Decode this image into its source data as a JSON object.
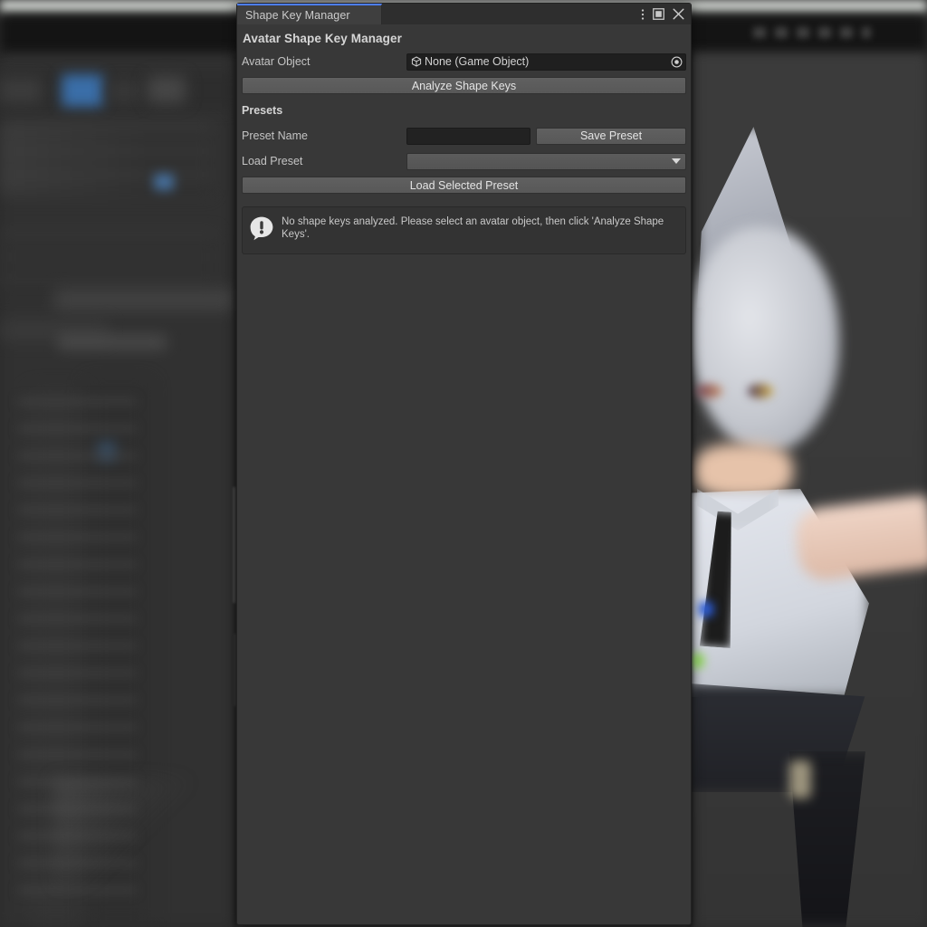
{
  "window": {
    "tab_label": "Shape Key Manager",
    "menu_icon": "kebab-menu-icon",
    "maximize_icon": "maximize-icon",
    "close_icon": "close-icon"
  },
  "header": {
    "title": "Avatar Shape Key Manager"
  },
  "avatar_object": {
    "label": "Avatar Object",
    "value": "None (Game Object)",
    "type_icon": "gameobject-cube-icon",
    "picker_icon": "object-picker-icon"
  },
  "analyze": {
    "label": "Analyze Shape Keys"
  },
  "presets": {
    "section_label": "Presets",
    "preset_name_label": "Preset Name",
    "preset_name_value": "",
    "preset_name_placeholder": "",
    "save_label": "Save Preset",
    "load_preset_label": "Load Preset",
    "load_preset_value": "",
    "load_selected_label": "Load Selected Preset",
    "dropdown_icon": "chevron-down-icon"
  },
  "helpbox": {
    "icon": "warning-speech-bubble-icon",
    "message": "No shape keys analyzed. Please select an avatar object, then click 'Analyze Shape Keys'."
  },
  "colors": {
    "panel_bg": "#383838",
    "tab_active_accent": "#4c7eff",
    "button_bg": "#5c5c5c",
    "field_bg": "#1f1f1f",
    "text": "#c4c4c4",
    "helpbox_bg": "#333333"
  }
}
